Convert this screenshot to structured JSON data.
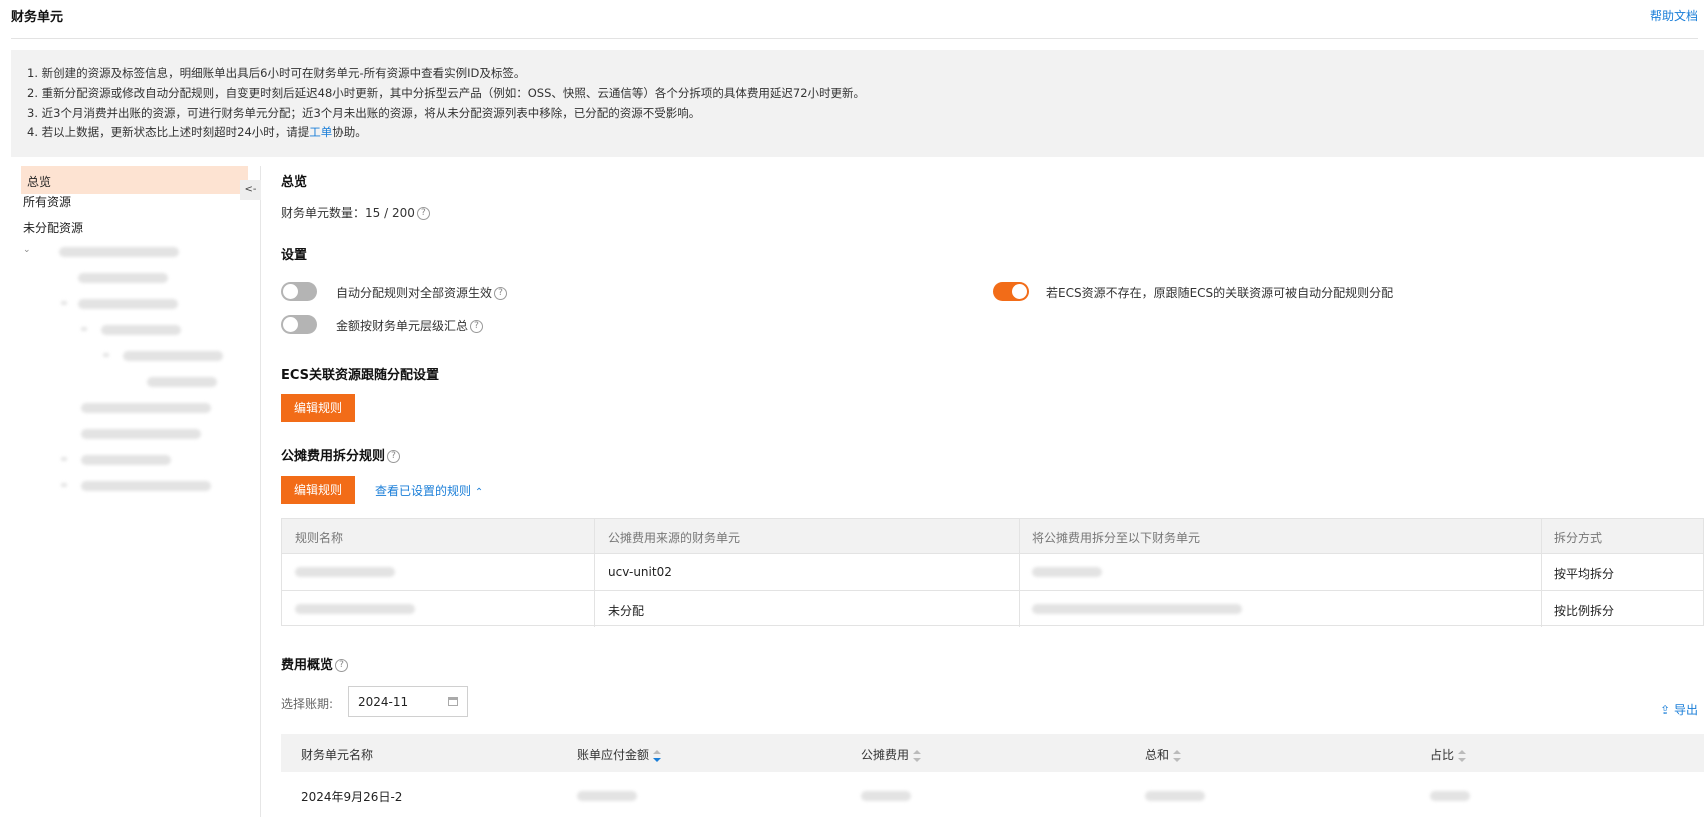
{
  "header": {
    "title": "财务单元",
    "help_link": "帮助文档"
  },
  "notice": {
    "lines": [
      "1. 新创建的资源及标签信息，明细账单出具后6小时可在财务单元-所有资源中查看实例ID及标签。",
      "2. 重新分配资源或修改自动分配规则，自变更时刻后延迟48小时更新，其中分拆型云产品（例如：OSS、快照、云通信等）各个分拆项的具体费用延迟72小时更新。",
      "3. 近3个月消费并出账的资源，可进行财务单元分配；近3个月未出账的资源，将从未分配资源列表中移除，已分配的资源不受影响。"
    ],
    "line4_prefix": "4. 若以上数据，更新状态比上述时刻超时24小时，请提",
    "line4_link": "工单",
    "line4_suffix": "协助。"
  },
  "sidebar": {
    "items": [
      {
        "label": "总览",
        "active": true
      },
      {
        "label": "所有资源"
      },
      {
        "label": "未分配资源"
      }
    ],
    "collapse_label": "<-",
    "tree_caret": "⌄"
  },
  "overview": {
    "title": "总览",
    "count_label": "财务单元数量：",
    "count_value": "15 / 200"
  },
  "settings": {
    "title": "设置",
    "toggle_auto_rule": {
      "label": "自动分配规则对全部资源生效",
      "on": false
    },
    "toggle_amount_summary": {
      "label": "金额按财务单元层级汇总",
      "on": false
    },
    "toggle_ecs_follow": {
      "label": "若ECS资源不存在，原跟随ECS的关联资源可被自动分配规则分配",
      "on": true
    }
  },
  "ecs_section": {
    "title": "ECS关联资源跟随分配设置",
    "edit_button": "编辑规则"
  },
  "split_section": {
    "title": "公摊费用拆分规则",
    "edit_button": "编辑规则",
    "view_link": "查看已设置的规则",
    "table": {
      "headers": [
        "规则名称",
        "公摊费用来源的财务单元",
        "将公摊费用拆分至以下财务单元",
        "拆分方式"
      ],
      "rows": [
        {
          "source": "ucv-unit02",
          "method": "按平均拆分"
        },
        {
          "source": "未分配",
          "method": "按比例拆分"
        }
      ]
    }
  },
  "fee_section": {
    "title": "费用概览",
    "period_label": "选择账期:",
    "period_value": "2024-11",
    "export_label": "导出",
    "table": {
      "headers": [
        "财务单元名称",
        "账单应付金额",
        "公摊费用",
        "总和",
        "占比"
      ],
      "rows": [
        {
          "name": "2024年9月26日-2"
        }
      ]
    }
  },
  "colors": {
    "accent": "#f26c18",
    "link": "#1a7ed8",
    "active_bg": "#fde3d2"
  },
  "icons": [
    "help-circle-icon",
    "chevron-up-icon",
    "calendar-icon",
    "export-icon",
    "sort-icon"
  ]
}
